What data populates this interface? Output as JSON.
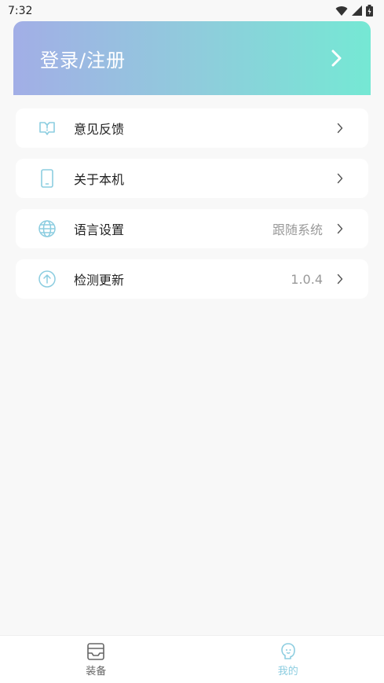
{
  "status": {
    "time": "7:32"
  },
  "login": {
    "title": "登录/注册"
  },
  "menu": [
    {
      "id": "feedback",
      "label": "意见反馈",
      "value": "",
      "icon": "feedback-icon"
    },
    {
      "id": "about",
      "label": "关于本机",
      "value": "",
      "icon": "phone-icon"
    },
    {
      "id": "language",
      "label": "语言设置",
      "value": "跟随系统",
      "icon": "globe-icon"
    },
    {
      "id": "update",
      "label": "检测更新",
      "value": "1.0.4",
      "icon": "upload-arrow-icon"
    }
  ],
  "tabs": [
    {
      "id": "equipment",
      "label": "装备",
      "icon": "equipment-icon",
      "active": false
    },
    {
      "id": "mine",
      "label": "我的",
      "icon": "profile-icon",
      "active": true
    }
  ],
  "colors": {
    "accent": "#8ccde0",
    "gradient_start": "#a2aee6",
    "gradient_end": "#75e8d4",
    "background": "#f8f8f8"
  }
}
